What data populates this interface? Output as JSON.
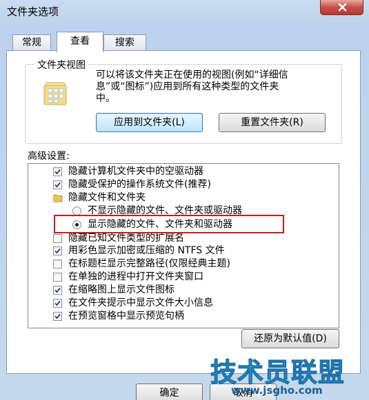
{
  "window": {
    "title": "文件夹选项"
  },
  "tabs": [
    {
      "label": "常规"
    },
    {
      "label": "查看"
    },
    {
      "label": "搜索"
    }
  ],
  "folder_views": {
    "legend": "文件夹视图",
    "description": "可以将该文件夹正在使用的视图(例如“详细信\n息”或“图标”)应用到所有这种类型的文件夹\n中。",
    "apply_button": "应用到文件夹(L)",
    "reset_button": "重置文件夹(R)"
  },
  "advanced": {
    "label": "高级设置:",
    "items": [
      {
        "type": "checkbox",
        "checked": true,
        "label": "隐藏计算机文件夹中的空驱动器"
      },
      {
        "type": "checkbox",
        "checked": true,
        "label": "隐藏受保护的操作系统文件(推荐)"
      },
      {
        "type": "folder",
        "label": "隐藏文件和文件夹"
      },
      {
        "type": "radio",
        "checked": false,
        "label": "不显示隐藏的文件、文件夹或驱动器"
      },
      {
        "type": "radio",
        "checked": true,
        "label": "显示隐藏的文件、文件夹和驱动器"
      },
      {
        "type": "checkbox",
        "checked": false,
        "label": "隐藏已知文件类型的扩展名"
      },
      {
        "type": "checkbox",
        "checked": true,
        "label": "用彩色显示加密或压缩的 NTFS 文件"
      },
      {
        "type": "checkbox",
        "checked": false,
        "label": "在标题栏显示完整路径(仅限经典主题)"
      },
      {
        "type": "checkbox",
        "checked": false,
        "label": "在单独的进程中打开文件夹窗口"
      },
      {
        "type": "checkbox",
        "checked": true,
        "label": "在缩略图上显示文件图标"
      },
      {
        "type": "checkbox",
        "checked": true,
        "label": "在文件夹提示中显示文件大小信息"
      },
      {
        "type": "checkbox",
        "checked": true,
        "label": "在预览窗格中显示预览句柄"
      }
    ],
    "restore_button": "还原为默认值(D)"
  },
  "footer": {
    "ok_button": "确定",
    "cancel_button": "取消"
  },
  "watermark": {
    "title": "技术员联盟",
    "url": "www.jsgho.com"
  },
  "colors": {
    "highlight": "#d01818",
    "watermark": "#33a9e0"
  }
}
